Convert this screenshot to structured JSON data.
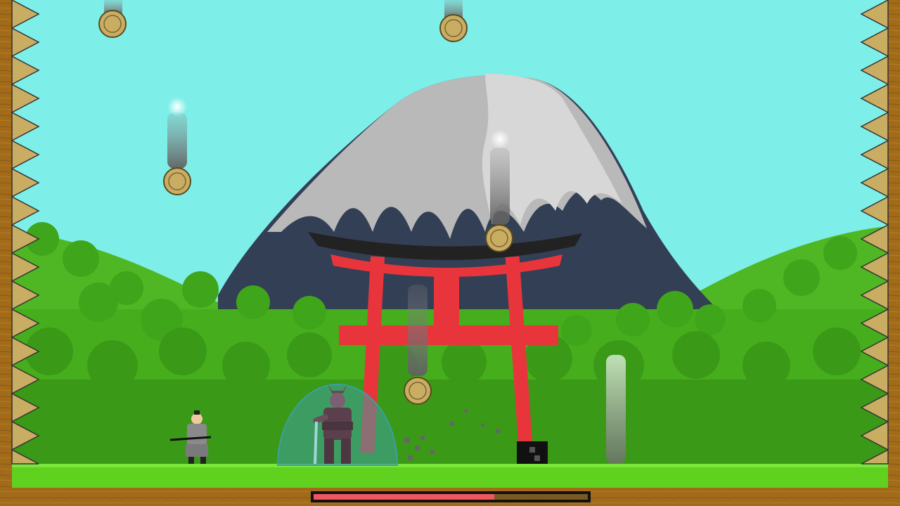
{
  "game": {
    "boss_health": 0.66,
    "colors": {
      "sky": "#7eeee9",
      "grass": "#5fd11e",
      "torii": "#e8353b",
      "mountain_dark": "#333f55",
      "mountain_snow": "#b9b9b9",
      "wood_border": "#a26b1a",
      "spike": "#c9ad63",
      "shield": "#3f9fa0",
      "health_fill": "#f0565f"
    }
  }
}
